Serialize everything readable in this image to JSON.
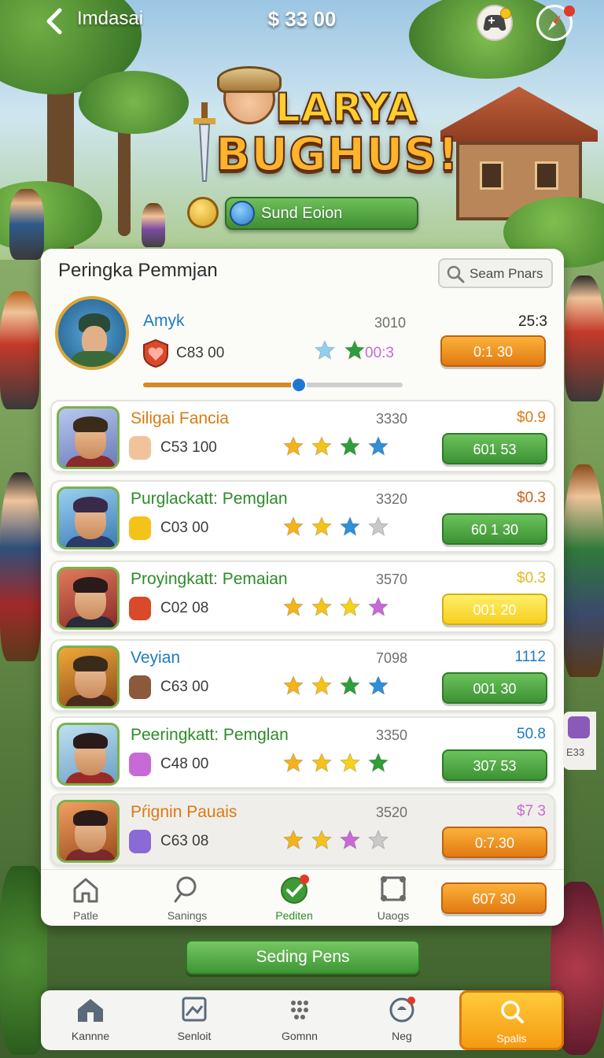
{
  "header": {
    "title": "Imdasai",
    "balance": "$ 33 00"
  },
  "logo": {
    "line1": "LARYA",
    "line2": "BUGHUS!"
  },
  "event": {
    "label": "Sund Eoion"
  },
  "leaderboard": {
    "title": "Peringka Pemmjan",
    "search_label": "Seam Pnars",
    "top_player": {
      "name": "Amyk",
      "score": "3010",
      "value": "25:3",
      "coins": "C83 00",
      "stat": "00:3",
      "button": "0:1 30",
      "progress": 0.6,
      "stars": [
        "#8fd0f0",
        "#2e9e3a"
      ],
      "colors": {
        "name": "#1e7bbf",
        "stat": "#c56ad8"
      }
    },
    "rows": [
      {
        "name": "Siligai Fancia",
        "score": "3330",
        "value": "$0.9",
        "coins": "C53 100",
        "button": "601 53",
        "button_style": "green",
        "name_color": "#d97a12",
        "value_color": "#d97a12",
        "stars": [
          "#f5b31a",
          "#f5c21a",
          "#2e9e3a",
          "#2f8fd8"
        ]
      },
      {
        "name": "Purglackatt: Pemglan",
        "score": "3320",
        "value": "$0.3",
        "coins": "C03 00",
        "button": "60 1 30",
        "button_style": "green",
        "name_color": "#2e8b2a",
        "value_color": "#c8621a",
        "stars": [
          "#f5b31a",
          "#f5c21a",
          "#2f8fd8",
          "#c9c9c9"
        ]
      },
      {
        "name": "Proyingkatt: Pemaian",
        "score": "3570",
        "value": "$0.3",
        "coins": "C02 08",
        "button": "001 20",
        "button_style": "yellow",
        "name_color": "#2e8b2a",
        "value_color": "#e0b91a",
        "stars": [
          "#f5b31a",
          "#f5c21a",
          "#f5d21a",
          "#c86ad6"
        ]
      },
      {
        "name": "Veyian",
        "score": "7098",
        "value": "1112",
        "coins": "C63 00",
        "button": "001 30",
        "button_style": "green",
        "name_color": "#1e7bbf",
        "value_color": "#1e7bbf",
        "stars": [
          "#f5b31a",
          "#f5c21a",
          "#2e9e3a",
          "#2f8fd8"
        ]
      },
      {
        "name": "Peeringkatt: Pemglan",
        "score": "3350",
        "value": "50.8",
        "coins": "C48 00",
        "button": "307 53",
        "button_style": "green",
        "name_color": "#2e8b2a",
        "value_color": "#1e7bbf",
        "stars": [
          "#f5b31a",
          "#f5c21a",
          "#f5d21a",
          "#2e9e3a"
        ]
      },
      {
        "name": "Pŕignin Pauais",
        "score": "3520",
        "value": "$7 3",
        "coins": "C63 08",
        "button": "0:7.30",
        "button_style": "orange",
        "name_color": "#d97a12",
        "value_color": "#c86ad6",
        "stars": [
          "#f5b31a",
          "#f5c21a",
          "#c86ad6",
          "#c9c9c9"
        ]
      }
    ]
  },
  "panel_nav": {
    "items": [
      {
        "label": "Patle",
        "icon": "home-outline-icon"
      },
      {
        "label": "Sanings",
        "icon": "search-outline-icon"
      },
      {
        "label": "Pediten",
        "icon": "check-circle-icon"
      },
      {
        "label": "Uaogs",
        "icon": "nodes-icon"
      }
    ],
    "button": "607 30"
  },
  "cta": {
    "label": "Seding Pens"
  },
  "bottom_nav": {
    "items": [
      {
        "label": "Kannne",
        "icon": "home-icon"
      },
      {
        "label": "Senloit",
        "icon": "image-frame-icon"
      },
      {
        "label": "Gomnn",
        "icon": "dots-grid-icon"
      },
      {
        "label": "Neg",
        "icon": "chat-bubble-icon"
      },
      {
        "label": "Spalis",
        "icon": "search-icon"
      }
    ]
  },
  "side_peek": {
    "text": "E33"
  }
}
